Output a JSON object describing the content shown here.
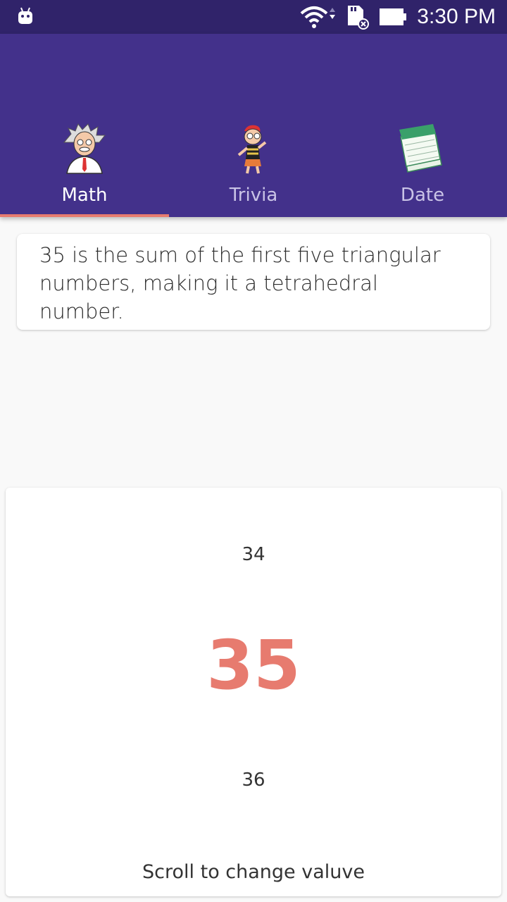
{
  "status_bar": {
    "time": "3:30 PM",
    "icons": [
      "android-icon",
      "wifi-icon",
      "sd-card-icon",
      "battery-icon"
    ]
  },
  "tabs": [
    {
      "label": "Math",
      "icon": "professor-icon",
      "active": true
    },
    {
      "label": "Trivia",
      "icon": "kid-character-icon",
      "active": false
    },
    {
      "label": "Date",
      "icon": "calendar-icon",
      "active": false
    }
  ],
  "fact": {
    "text": "35 is the sum of the first five triangular numbers, making it a tetrahedral number."
  },
  "picker": {
    "previous": "34",
    "current": "35",
    "next": "36",
    "hint": "Scroll to change valuve"
  },
  "colors": {
    "status_bar": "#30236a",
    "app_bar": "#43318b",
    "accent": "#e77b6f"
  }
}
